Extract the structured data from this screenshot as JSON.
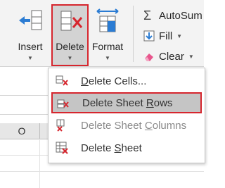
{
  "ribbon": {
    "insert": {
      "label": "Insert",
      "icon": "insert-cells-icon"
    },
    "delete": {
      "label": "Delete",
      "icon": "delete-cells-icon"
    },
    "format": {
      "label": "Format",
      "icon": "format-cells-icon"
    },
    "autosum": {
      "label": "AutoSum",
      "icon": "sigma-icon"
    },
    "fill": {
      "label": "Fill",
      "icon": "fill-down-icon"
    },
    "clear": {
      "label": "Clear",
      "icon": "eraser-icon"
    }
  },
  "sheet": {
    "column_header": "O"
  },
  "delete_menu": {
    "items": [
      {
        "label_pre": "",
        "label_ul": "D",
        "label_post": "elete Cells...",
        "icon": "delete-cells-icon",
        "state": "normal"
      },
      {
        "label_pre": "Delete Sheet ",
        "label_ul": "R",
        "label_post": "ows",
        "icon": "delete-rows-icon",
        "state": "selected"
      },
      {
        "label_pre": "Delete Sheet ",
        "label_ul": "C",
        "label_post": "olumns",
        "icon": "delete-columns-icon",
        "state": "disabled"
      },
      {
        "label_pre": "Delete ",
        "label_ul": "S",
        "label_post": "heet",
        "icon": "delete-sheet-icon",
        "state": "normal"
      }
    ]
  },
  "colors": {
    "accent_red": "#d6262e",
    "highlight_bg": "#c5c5c5",
    "ribbon_bg": "#f3f3f3"
  }
}
